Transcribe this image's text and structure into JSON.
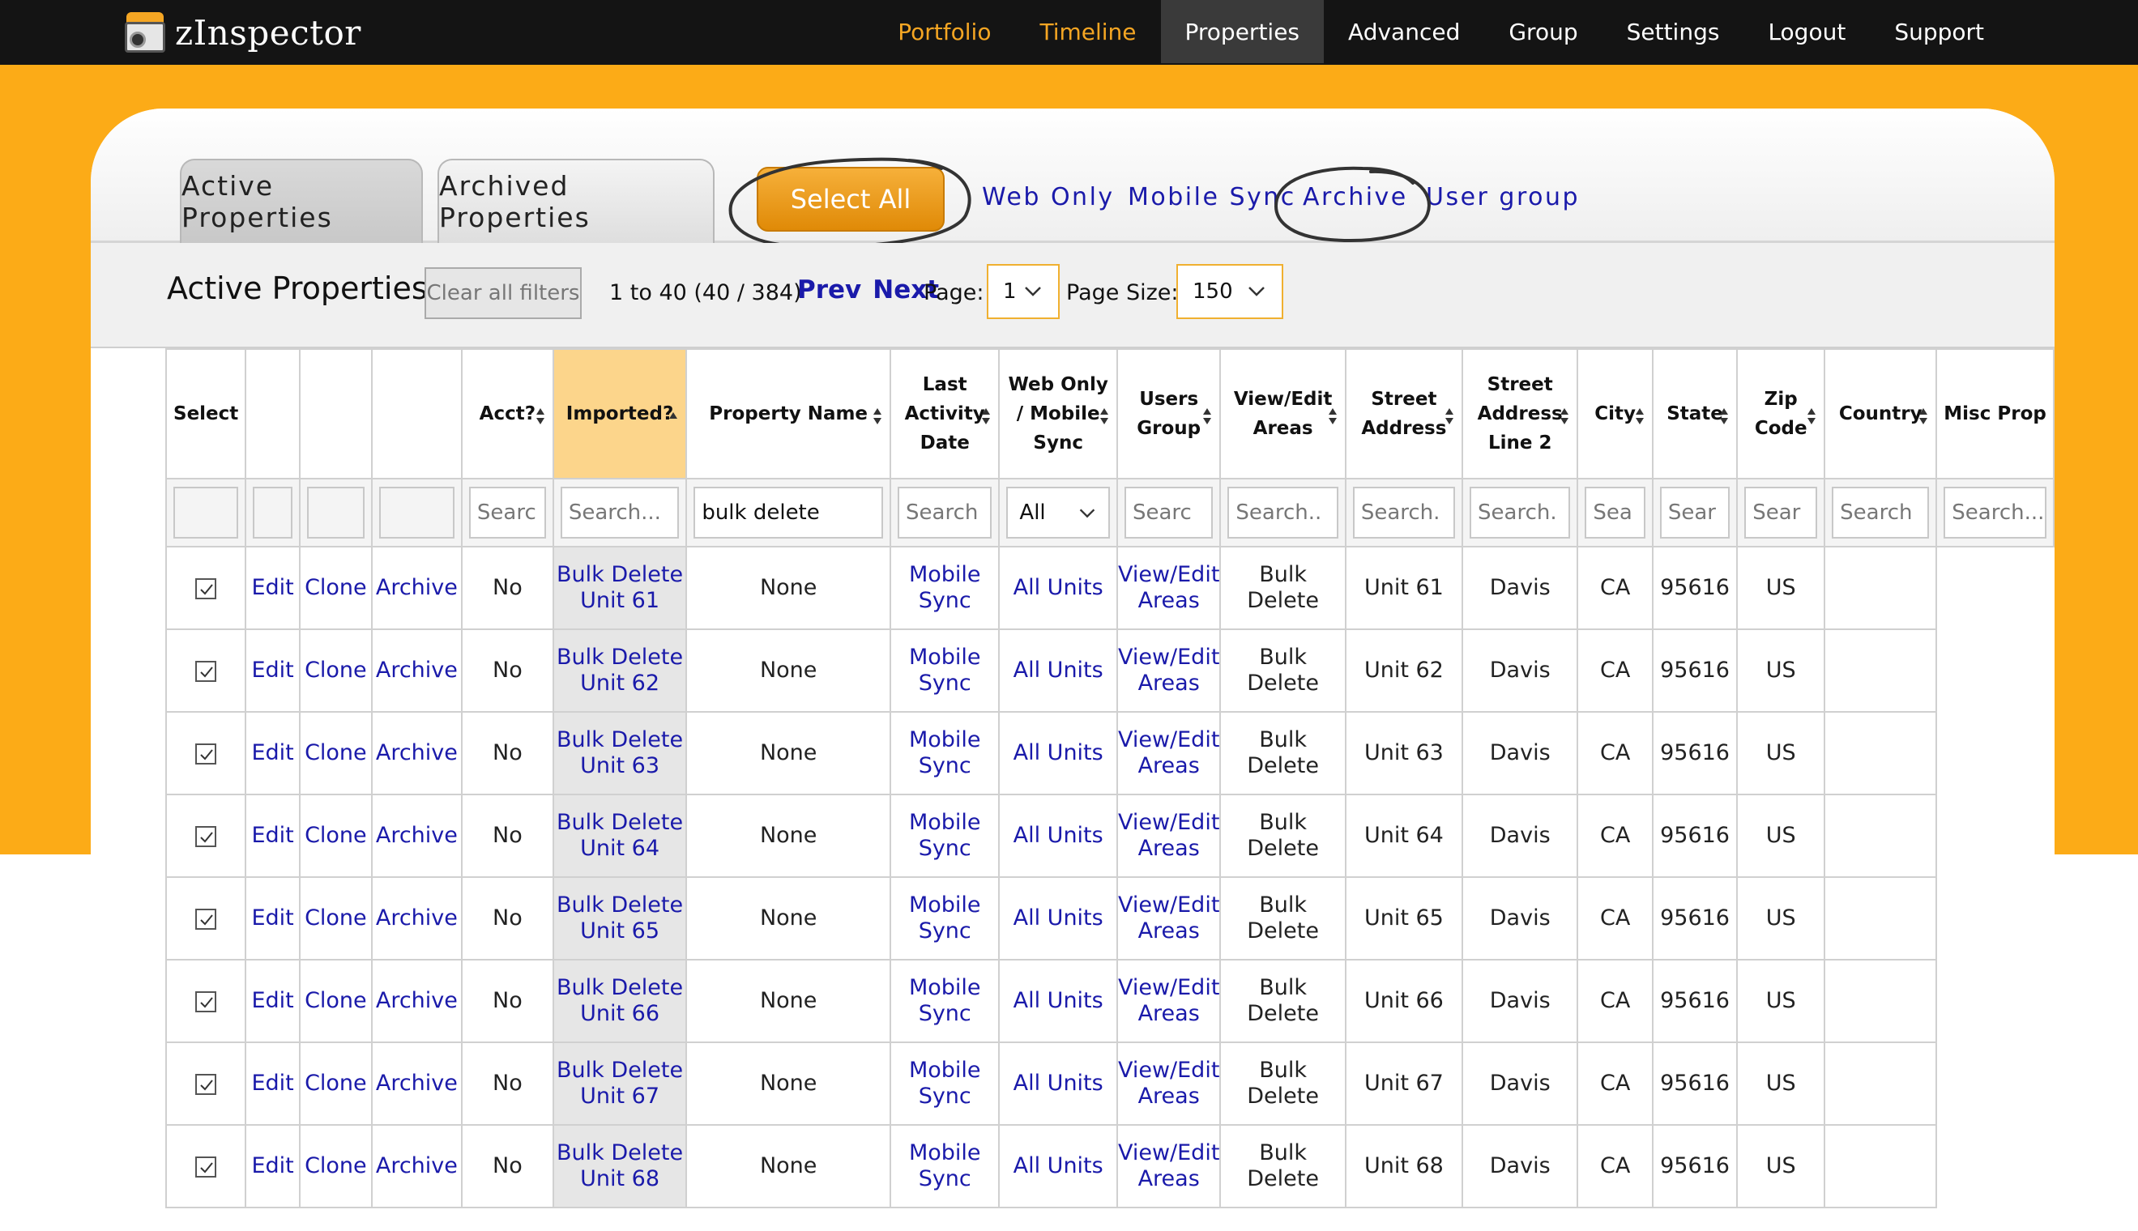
{
  "app": {
    "name": "zInspector",
    "nav": [
      {
        "label": "Portfolio",
        "state": "orange"
      },
      {
        "label": "Timeline",
        "state": "orange"
      },
      {
        "label": "Properties",
        "state": "active"
      },
      {
        "label": "Advanced",
        "state": "normal"
      },
      {
        "label": "Group",
        "state": "normal"
      },
      {
        "label": "Settings",
        "state": "normal"
      },
      {
        "label": "Logout",
        "state": "normal"
      },
      {
        "label": "Support",
        "state": "normal"
      }
    ]
  },
  "tabs": {
    "active": "Active Properties",
    "archived": "Archived Properties"
  },
  "actions": {
    "select_all": "Select All",
    "web_only": "Web Only",
    "mobile_sync": "Mobile Sync",
    "archive": "Archive",
    "user_group": "User group"
  },
  "toolbar": {
    "title": "Active Properties",
    "clear_filters": "Clear all filters",
    "range": "1 to 40 (40 / 384)",
    "prev": "Prev",
    "next": "Next",
    "page_label": "Page:",
    "page_value": "1",
    "page_size_label": "Page Size:",
    "page_size_value": "150"
  },
  "table": {
    "headers": {
      "select": "Select",
      "acct": "Acct?",
      "imported": "Imported?",
      "property_name": "Property Name",
      "last_activity": "Last Activity Date",
      "web_mobile": "Web Only / Mobile Sync",
      "users_group": "Users Group",
      "view_edit": "View/Edit Areas",
      "street": "Street Address",
      "street2": "Street Address Line 2",
      "city": "City",
      "state": "State",
      "zip": "Zip Code",
      "country": "Country",
      "misc": "Misc Prop"
    },
    "filters": {
      "search_placeholder": "Search...",
      "acct": "Searc",
      "imported": "Search...",
      "property_name": "bulk delete",
      "last_activity": "Search",
      "web_mobile": "All",
      "users_group": "Searc",
      "view_edit": "Search..",
      "street": "Search.",
      "street2": "Search.",
      "city": "Sea",
      "state": "Sear",
      "zip": "Sear",
      "country": "Search",
      "misc": "Search..."
    },
    "row_links": {
      "edit": "Edit",
      "clone": "Clone",
      "archive": "Archive"
    },
    "rows": [
      {
        "acct": "No",
        "name": "Bulk Delete Unit 61",
        "last": "None",
        "sync": "Mobile Sync",
        "group": "All Units",
        "areas": "View/Edit Areas",
        "street": "Bulk Delete",
        "street2": "Unit 61",
        "city": "Davis",
        "state": "CA",
        "zip": "95616",
        "country": "US"
      },
      {
        "acct": "No",
        "name": "Bulk Delete Unit 62",
        "last": "None",
        "sync": "Mobile Sync",
        "group": "All Units",
        "areas": "View/Edit Areas",
        "street": "Bulk Delete",
        "street2": "Unit 62",
        "city": "Davis",
        "state": "CA",
        "zip": "95616",
        "country": "US"
      },
      {
        "acct": "No",
        "name": "Bulk Delete Unit 63",
        "last": "None",
        "sync": "Mobile Sync",
        "group": "All Units",
        "areas": "View/Edit Areas",
        "street": "Bulk Delete",
        "street2": "Unit 63",
        "city": "Davis",
        "state": "CA",
        "zip": "95616",
        "country": "US"
      },
      {
        "acct": "No",
        "name": "Bulk Delete Unit 64",
        "last": "None",
        "sync": "Mobile Sync",
        "group": "All Units",
        "areas": "View/Edit Areas",
        "street": "Bulk Delete",
        "street2": "Unit 64",
        "city": "Davis",
        "state": "CA",
        "zip": "95616",
        "country": "US"
      },
      {
        "acct": "No",
        "name": "Bulk Delete Unit 65",
        "last": "None",
        "sync": "Mobile Sync",
        "group": "All Units",
        "areas": "View/Edit Areas",
        "street": "Bulk Delete",
        "street2": "Unit 65",
        "city": "Davis",
        "state": "CA",
        "zip": "95616",
        "country": "US"
      },
      {
        "acct": "No",
        "name": "Bulk Delete Unit 66",
        "last": "None",
        "sync": "Mobile Sync",
        "group": "All Units",
        "areas": "View/Edit Areas",
        "street": "Bulk Delete",
        "street2": "Unit 66",
        "city": "Davis",
        "state": "CA",
        "zip": "95616",
        "country": "US"
      },
      {
        "acct": "No",
        "name": "Bulk Delete Unit 67",
        "last": "None",
        "sync": "Mobile Sync",
        "group": "All Units",
        "areas": "View/Edit Areas",
        "street": "Bulk Delete",
        "street2": "Unit 67",
        "city": "Davis",
        "state": "CA",
        "zip": "95616",
        "country": "US"
      },
      {
        "acct": "No",
        "name": "Bulk Delete Unit 68",
        "last": "None",
        "sync": "Mobile Sync",
        "group": "All Units",
        "areas": "View/Edit Areas",
        "street": "Bulk Delete",
        "street2": "Unit 68",
        "city": "Davis",
        "state": "CA",
        "zip": "95616",
        "country": "US"
      }
    ]
  },
  "colors": {
    "nav_bg": "#141414",
    "brand_orange": "#fcab17",
    "link_blue": "#1a1aaa",
    "sorted_header": "#fcd58b"
  }
}
